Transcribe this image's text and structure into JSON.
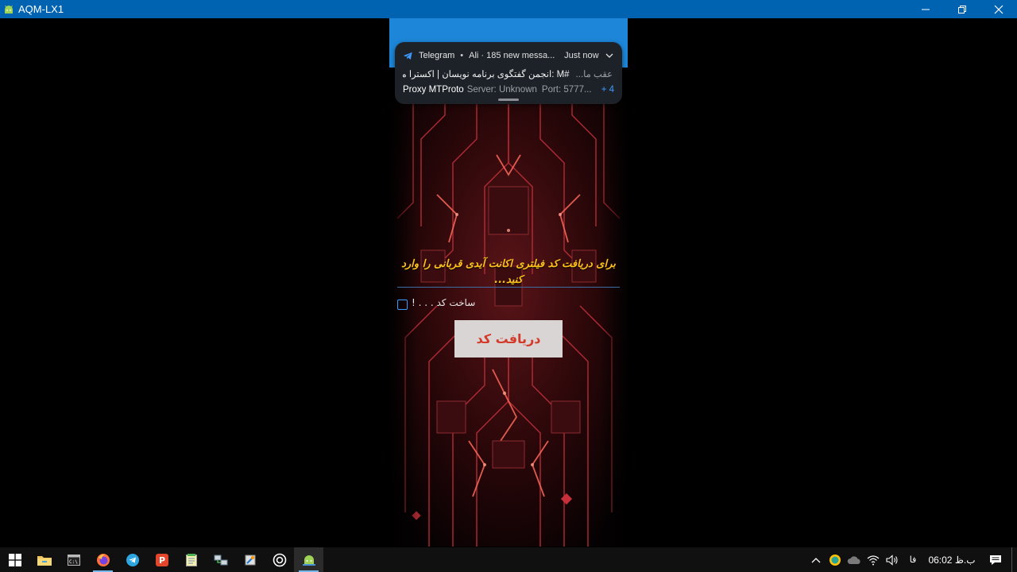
{
  "window": {
    "title": "AQM-LX1",
    "controls": [
      "minimize",
      "restore",
      "close"
    ]
  },
  "notification": {
    "app": "Telegram",
    "summary": "Ali · 185 new messa...",
    "time": "Just now",
    "sender": "عقب ما...",
    "message": "#M :انجمن گفتگوی برنامه نویسان | اکسترا مگ",
    "line2_title": "Proxy MTProto",
    "line2_server": "Server: Unknown",
    "line2_port": "Port: 5777...",
    "more": "+ 4"
  },
  "form": {
    "prompt": "برای دریافت کد فیلتری اکانت آیدی قربانی را وارد کنید...",
    "checkbox_label": "ساخت کد . . . !",
    "submit_label": "دریافت کد"
  },
  "taskbar": {
    "apps": [
      {
        "name": "start",
        "icon": "windows-logo"
      },
      {
        "name": "file-explorer",
        "icon": "folder-icon"
      },
      {
        "name": "command-prompt",
        "icon": "terminal-icon"
      },
      {
        "name": "firefox",
        "icon": "firefox-icon"
      },
      {
        "name": "telegram",
        "icon": "telegram-icon"
      },
      {
        "name": "psiphon",
        "icon": "psiphon-icon"
      },
      {
        "name": "notepad",
        "icon": "notepad-icon"
      },
      {
        "name": "network-tool",
        "icon": "network-icon"
      },
      {
        "name": "settings-tool",
        "icon": "tool-icon"
      },
      {
        "name": "scrcpy",
        "icon": "target-icon"
      },
      {
        "name": "android-mirror",
        "icon": "android-icon",
        "active": true
      }
    ],
    "tray": {
      "language": "فا",
      "clock": "06:02 ب.ظ"
    }
  },
  "colors": {
    "titlebar": "#0063b1",
    "prompt": "#ffc21a",
    "button_text": "#d43a2a",
    "phone_topbar": "#1d86d8"
  }
}
